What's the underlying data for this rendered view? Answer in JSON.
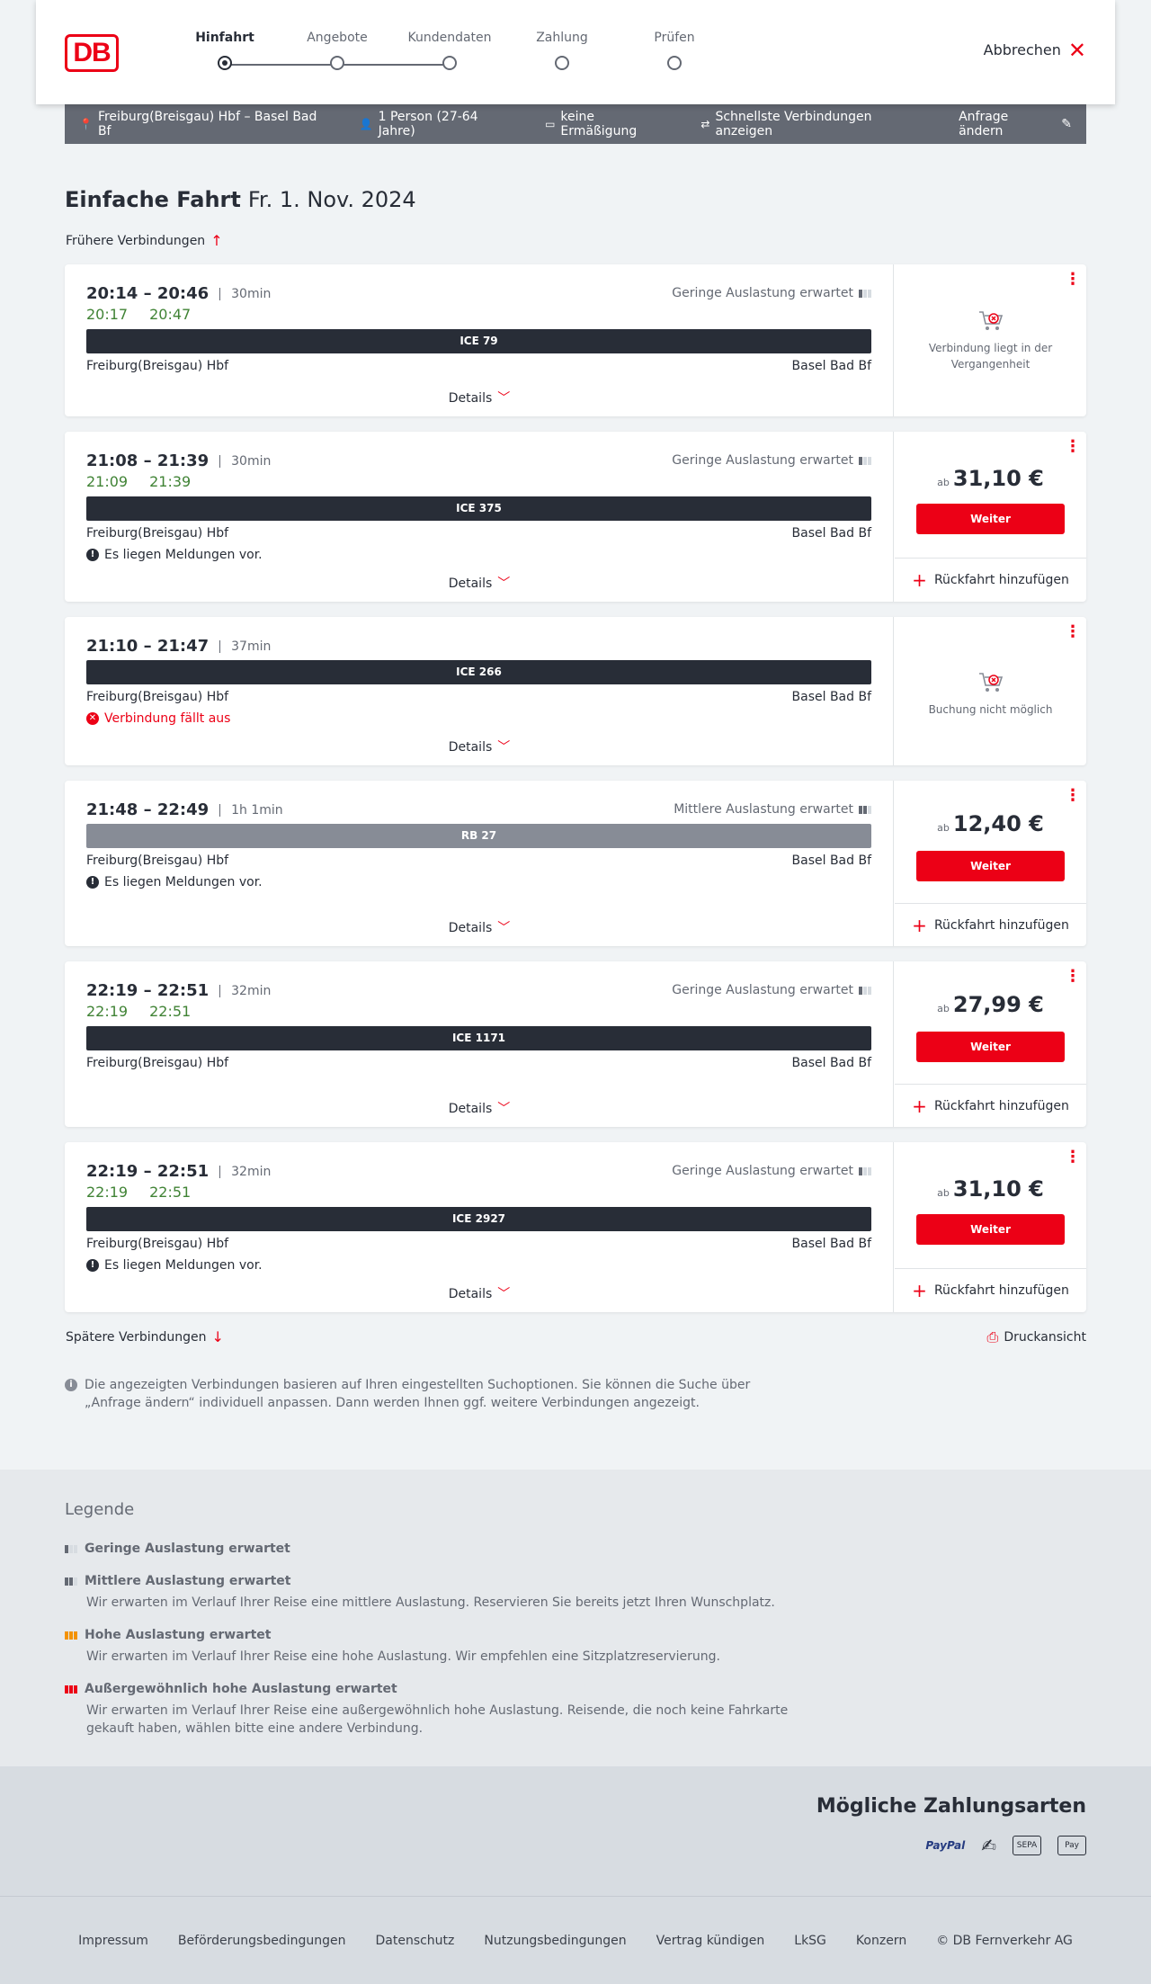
{
  "header": {
    "logo": "DB",
    "steps": [
      "Hinfahrt",
      "Angebote",
      "Kundendaten",
      "Zahlung",
      "Prüfen"
    ],
    "cancel_label": "Abbrechen"
  },
  "search": {
    "route": "Freiburg(Breisgau) Hbf – Basel Bad Bf",
    "persons": "1 Person (27-64 Jahre)",
    "discount": "keine Ermäßigung",
    "fastest": "Schnellste Verbindungen anzeigen",
    "change": "Anfrage ändern"
  },
  "title": {
    "type": "Einfache Fahrt",
    "date": "Fr. 1. Nov. 2024"
  },
  "earlier_label": "Frühere Verbindungen",
  "later_label": "Spätere Verbindungen",
  "print_label": "Druckansicht",
  "details_label": "Details",
  "weiter_label": "Weiter",
  "return_label": "Rückfahrt hinzufügen",
  "ab_label": "ab",
  "connections": [
    {
      "times": "20:14 – 20:46",
      "duration": "30min",
      "rt_dep": "20:17",
      "rt_arr": "20:47",
      "load": "Geringe Auslastung erwartet",
      "train": "ICE 79",
      "from": "Freiburg(Breisgau) Hbf",
      "to": "Basel Bad Bf",
      "status": "Verbindung liegt in der Vergangenheit"
    },
    {
      "times": "21:08 – 21:39",
      "duration": "30min",
      "rt_dep": "21:09",
      "rt_arr": "21:39",
      "load": "Geringe Auslastung erwartet",
      "train": "ICE 375",
      "from": "Freiburg(Breisgau) Hbf",
      "to": "Basel Bad Bf",
      "message": "Es liegen Meldungen vor.",
      "price": "31,10 €"
    },
    {
      "times": "21:10 – 21:47",
      "duration": "37min",
      "train": "ICE 266",
      "from": "Freiburg(Breisgau) Hbf",
      "to": "Basel Bad Bf",
      "message": "Verbindung fällt aus",
      "status": "Buchung nicht möglich"
    },
    {
      "times": "21:48 – 22:49",
      "duration": "1h 1min",
      "load": "Mittlere Auslastung erwartet",
      "train": "RB 27",
      "from": "Freiburg(Breisgau) Hbf",
      "to": "Basel Bad Bf",
      "message": "Es liegen Meldungen vor.",
      "price": "12,40 €"
    },
    {
      "times": "22:19 – 22:51",
      "duration": "32min",
      "rt_dep": "22:19",
      "rt_arr": "22:51",
      "load": "Geringe Auslastung erwartet",
      "train": "ICE 1171",
      "from": "Freiburg(Breisgau) Hbf",
      "to": "Basel Bad Bf",
      "price": "27,99 €"
    },
    {
      "times": "22:19 – 22:51",
      "duration": "32min",
      "rt_dep": "22:19",
      "rt_arr": "22:51",
      "load": "Geringe Auslastung erwartet",
      "train": "ICE 2927",
      "from": "Freiburg(Breisgau) Hbf",
      "to": "Basel Bad Bf",
      "message": "Es liegen Meldungen vor.",
      "price": "31,10 €"
    }
  ],
  "info_text": "Die angezeigten Verbindungen basieren auf Ihren eingestellten Suchoptionen. Sie können die Suche über „Anfrage ändern“ individuell anpassen. Dann werden Ihnen ggf. weitere Verbindungen angezeigt.",
  "legend": {
    "title": "Legende",
    "items": [
      {
        "head": "Geringe Auslastung erwartet",
        "text": ""
      },
      {
        "head": "Mittlere Auslastung erwartet",
        "text": "Wir erwarten im Verlauf Ihrer Reise eine mittlere Auslastung. Reservieren Sie bereits jetzt Ihren Wunschplatz."
      },
      {
        "head": "Hohe Auslastung erwartet",
        "text": "Wir erwarten im Verlauf Ihrer Reise eine hohe Auslastung. Wir empfehlen eine Sitzplatzreservierung."
      },
      {
        "head": "Außergewöhnlich hohe Auslastung erwartet",
        "text": "Wir erwarten im Verlauf Ihrer Reise eine außergewöhnlich hohe Auslastung. Reisende, die noch keine Fahrkarte gekauft haben, wählen bitte eine andere Verbindung."
      }
    ],
    "colors": {
      "low": "#646973",
      "high": "#f39200",
      "extreme": "#ec0016"
    }
  },
  "payment": {
    "title": "Mögliche Zahlungsarten",
    "paypal": "PayPal",
    "sepa": "SEPA",
    "applepay": "Pay"
  },
  "footer": [
    "Impressum",
    "Beförderungsbedingungen",
    "Datenschutz",
    "Nutzungsbedingungen",
    "Vertrag kündigen",
    "LkSG",
    "Konzern",
    "© DB Fernverkehr AG"
  ]
}
